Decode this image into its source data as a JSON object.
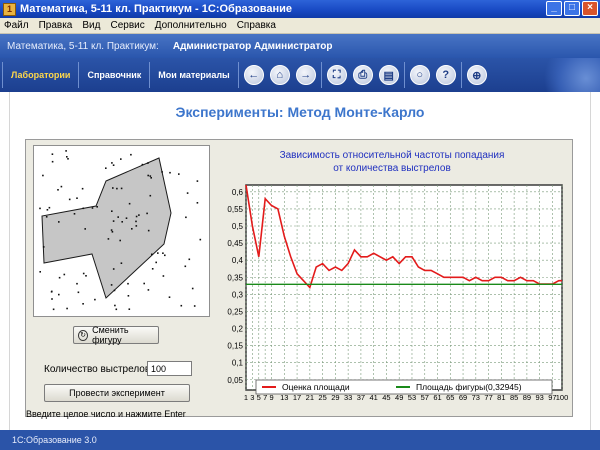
{
  "window": {
    "title": "Математика, 5-11 кл. Практикум - 1С:Образование",
    "app_icon_letter": "1"
  },
  "menu": [
    "Файл",
    "Правка",
    "Вид",
    "Сервис",
    "Дополнительно",
    "Справка"
  ],
  "header": {
    "course": "Математика, 5-11 кл. Практикум:",
    "user": "Администратор Администратор"
  },
  "nav": {
    "tabs": [
      "Лаборатории",
      "Справочник",
      "Мои материалы"
    ],
    "active_tab": 0,
    "icons": [
      "back-icon",
      "home-icon",
      "forward-icon",
      "fullscreen-icon",
      "print-icon",
      "bookmark-icon",
      "search-icon",
      "help-icon",
      "zoom-icon"
    ]
  },
  "page": {
    "title": "Эксперименты: Метод Монте-Карло"
  },
  "controls": {
    "change_figure": "Сменить фигуру",
    "shots_label": "Количество выстрелов:",
    "shots_value": "100",
    "run_experiment": "Провести эксперимент",
    "hint": "Введите целое число и нажмите Enter"
  },
  "statusbar": {
    "text": "1С:Образование 3.0"
  },
  "colors": {
    "estimate_line": "#e31b1b",
    "area_line": "#1a8a1a",
    "title_blue": "#3d76cc"
  },
  "chart_data": {
    "type": "line",
    "title": "Зависимость относительной частоты попадания от количества выстрелов",
    "title_lines": [
      "Зависимость относительной частоты попадания",
      "от количества выстрелов"
    ],
    "xlabel": "",
    "ylabel": "",
    "xlim": [
      1,
      100
    ],
    "ylim": [
      0.05,
      0.6
    ],
    "x_ticks": [
      1,
      3,
      5,
      7,
      9,
      13,
      17,
      21,
      25,
      29,
      33,
      37,
      41,
      45,
      49,
      53,
      57,
      61,
      65,
      69,
      73,
      77,
      81,
      85,
      89,
      93,
      97,
      100
    ],
    "y_ticks": [
      0.05,
      0.1,
      0.15,
      0.2,
      0.25,
      0.3,
      0.35,
      0.4,
      0.45,
      0.5,
      0.55,
      0.6
    ],
    "y_tick_labels": [
      "0,05",
      "0,1",
      "0,15",
      "0,2",
      "0,25",
      "0,3",
      "0,35",
      "0,4",
      "0,45",
      "0,5",
      "0,55",
      "0,6"
    ],
    "grid": true,
    "legend_position": "bottom",
    "series": [
      {
        "name": "Оценка площади",
        "x": [
          1,
          3,
          5,
          7,
          9,
          11,
          13,
          15,
          17,
          19,
          21,
          23,
          25,
          27,
          29,
          31,
          33,
          35,
          37,
          39,
          41,
          43,
          45,
          47,
          49,
          51,
          53,
          55,
          57,
          59,
          61,
          63,
          65,
          67,
          69,
          71,
          73,
          75,
          77,
          79,
          81,
          83,
          85,
          87,
          89,
          91,
          93,
          95,
          97,
          99,
          100
        ],
        "values": [
          0.62,
          0.5,
          0.41,
          0.58,
          0.56,
          0.55,
          0.47,
          0.41,
          0.36,
          0.34,
          0.32,
          0.38,
          0.39,
          0.37,
          0.38,
          0.37,
          0.39,
          0.43,
          0.41,
          0.41,
          0.42,
          0.41,
          0.4,
          0.41,
          0.39,
          0.41,
          0.41,
          0.38,
          0.37,
          0.37,
          0.36,
          0.35,
          0.35,
          0.35,
          0.35,
          0.34,
          0.35,
          0.34,
          0.34,
          0.35,
          0.35,
          0.34,
          0.34,
          0.35,
          0.34,
          0.34,
          0.33,
          0.33,
          0.33,
          0.34,
          0.34
        ]
      },
      {
        "name": "Площадь фигуры(0,32945)",
        "x": [
          1,
          100
        ],
        "values": [
          0.32945,
          0.32945
        ]
      }
    ]
  }
}
